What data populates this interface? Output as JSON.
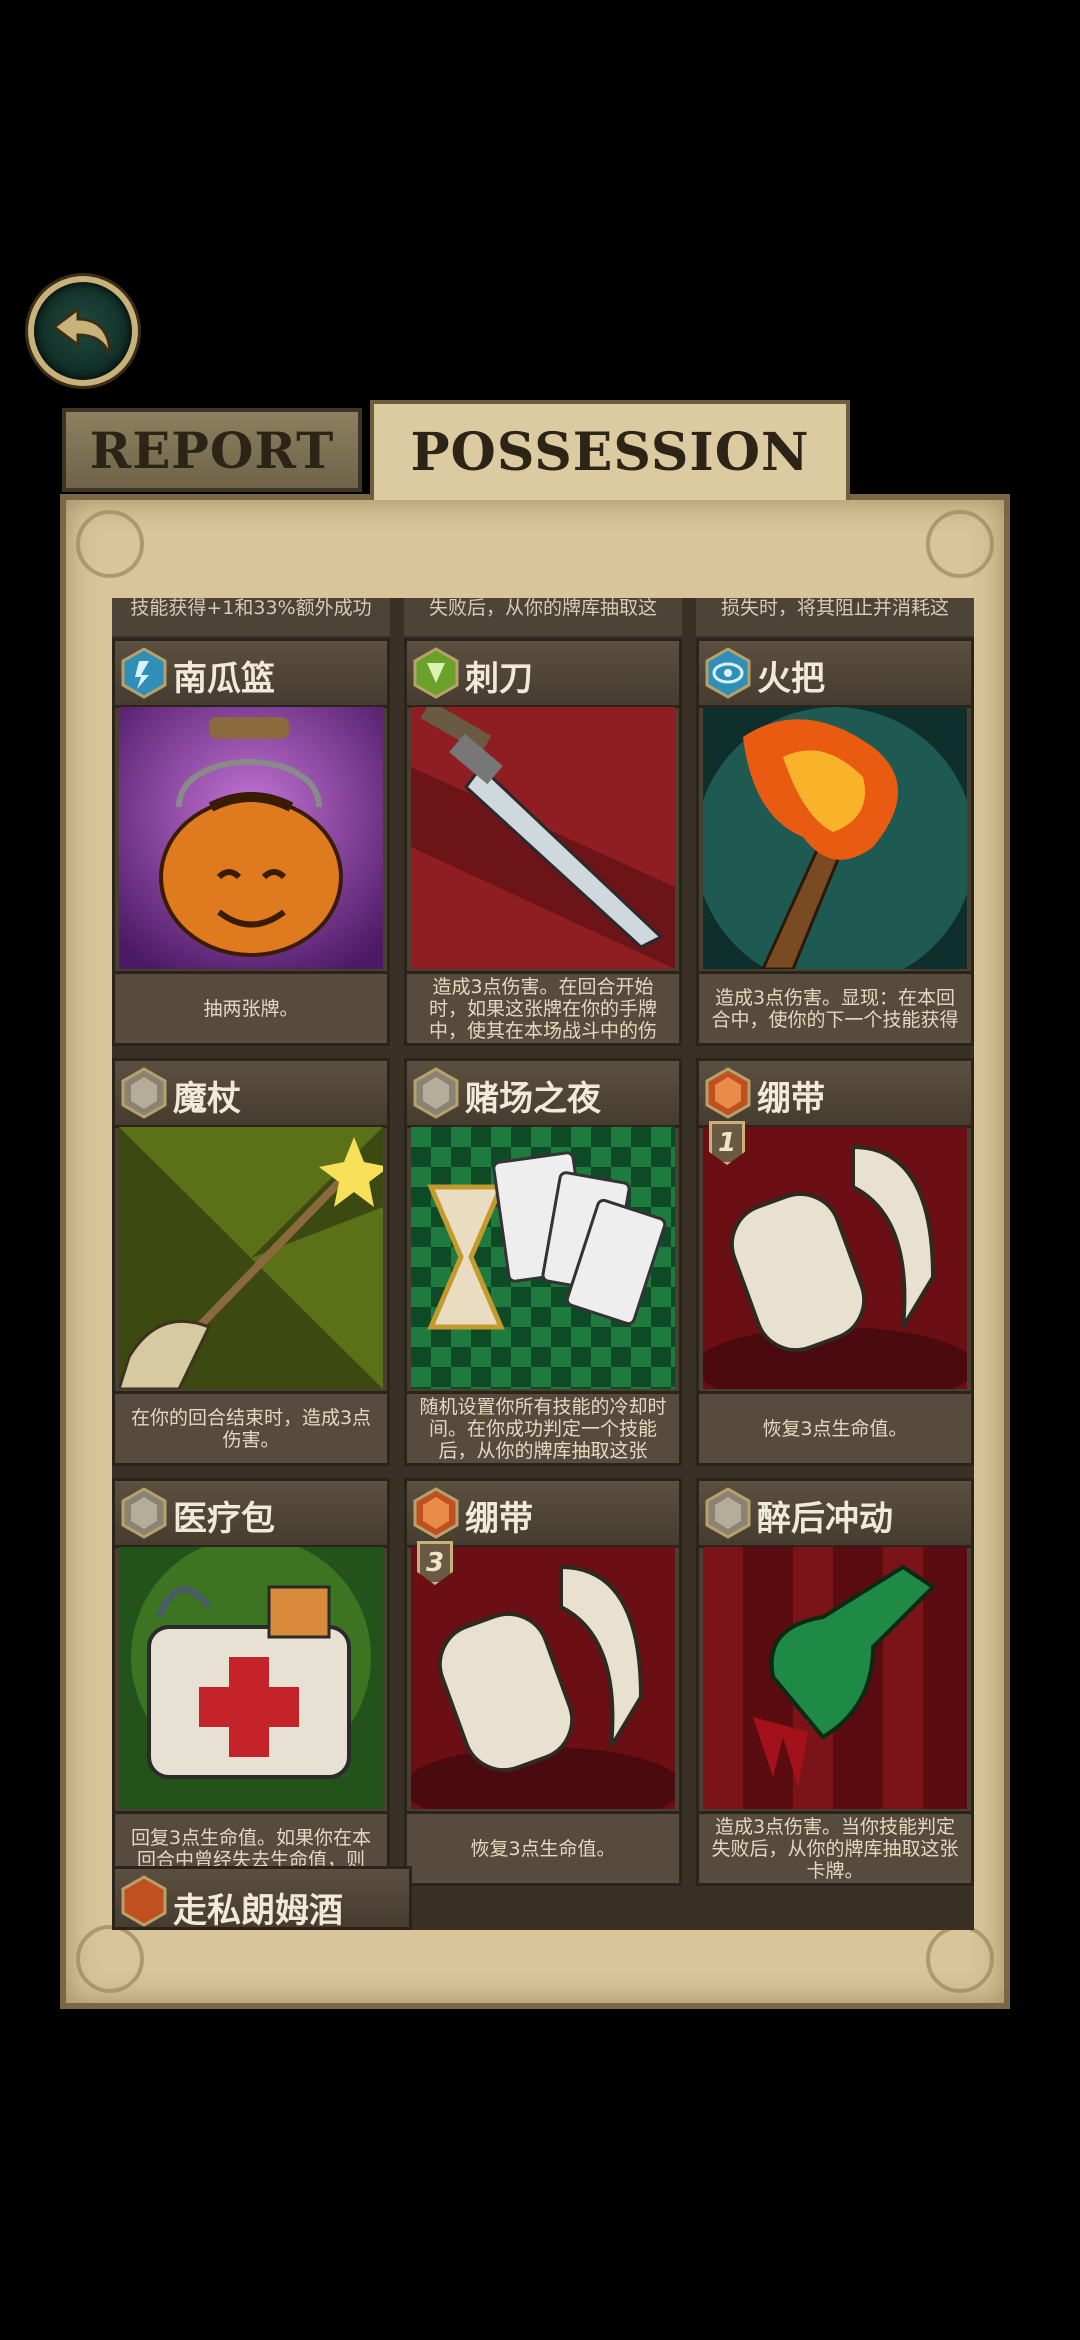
{
  "tabs": {
    "report_label": "REPORT",
    "possession_label": "POSSESSION"
  },
  "top_strip": [
    "技能获得+1和33%额外成功",
    "失败后，从你的牌库抽取这",
    "损失时，将其阻止并消耗这"
  ],
  "cards": [
    {
      "name": "南瓜篮",
      "desc": "抽两张牌。",
      "rarity": "blue",
      "art": "pumpkin-basket"
    },
    {
      "name": "刺刀",
      "desc": "造成3点伤害。在回合开始时，如果这张牌在你的手牌中，使其在本场战斗中的伤",
      "rarity": "green",
      "art": "bayonet"
    },
    {
      "name": "火把",
      "desc": "造成3点伤害。显现：在本回合中，使你的下一个技能获得",
      "rarity": "blue",
      "art": "torch"
    },
    {
      "name": "魔杖",
      "desc": "在你的回合结束时，造成3点伤害。",
      "rarity": "gray",
      "art": "wand"
    },
    {
      "name": "赌场之夜",
      "desc": "随机设置你所有技能的冷却时间。在你成功判定一个技能后，从你的牌库抽取这张",
      "rarity": "gray",
      "art": "casino-night"
    },
    {
      "name": "绷带",
      "desc": "恢复3点生命值。",
      "rarity": "orange",
      "cost": "1",
      "art": "bandage"
    },
    {
      "name": "医疗包",
      "desc": "回复3点生命值。如果你在本回合中曾经失去生命值，则",
      "rarity": "gray",
      "art": "medkit"
    },
    {
      "name": "绷带",
      "desc": "恢复3点生命值。",
      "rarity": "orange",
      "cost": "3",
      "art": "bandage"
    },
    {
      "name": "醉后冲动",
      "desc": "造成3点伤害。当你技能判定失败后，从你的牌库抽取这张卡牌。",
      "rarity": "gray",
      "art": "drunken-impulse"
    }
  ],
  "partial_card": {
    "name": "走私朗姆酒",
    "rarity": "orange"
  },
  "colors": {
    "background": "#000000",
    "parchment": "#d8c59a",
    "card_dark": "#4a4032",
    "back_button": "#1f4a3f"
  }
}
